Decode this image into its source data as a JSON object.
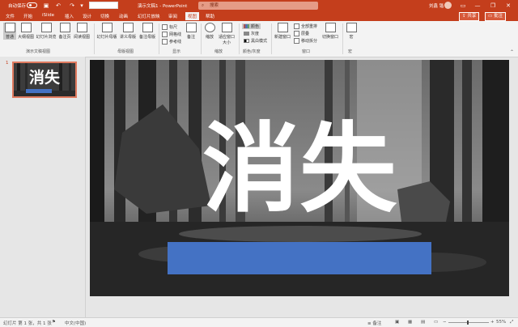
{
  "titlebar": {
    "autosave": "自动保存",
    "doc_title": "演示文稿1 - PowerPoint",
    "search_placeholder": "搜索",
    "user": "刘鑫 锴",
    "minimize": "—",
    "restore": "❐",
    "close": "✕",
    "undo": "↶",
    "redo": "↷",
    "save": "▣"
  },
  "tabs": [
    "文件",
    "开始",
    "iSlide",
    "插入",
    "设计",
    "切换",
    "动画",
    "幻灯片放映",
    "审阅",
    "视图",
    "帮助"
  ],
  "active_tab": "视图",
  "share_label": "共享",
  "comment_label": "批注",
  "ribbon": {
    "buttons": {
      "normal": "普通",
      "outline": "大纲视图",
      "sorter": "幻灯片浏览",
      "notes_page": "备注页",
      "reading": "阅读视图",
      "slide_master": "幻灯片母版",
      "handout_master": "讲义母版",
      "notes_master": "备注母版",
      "notes": "备注",
      "zoom": "缩放",
      "fit": "适应窗口大小",
      "new_window": "新建窗口",
      "switch_window": "切换窗口",
      "macro": "宏"
    },
    "show": {
      "ruler": "标尺",
      "gridlines": "网格线",
      "guides": "参考线"
    },
    "color": {
      "color": "颜色",
      "grayscale": "灰度",
      "bw": "黑白模式"
    },
    "window_items": {
      "arrange": "全部重排",
      "cascade": "层叠",
      "move_split": "移动拆分"
    },
    "groups": {
      "presentation_views": "演示文稿视图",
      "master_views": "母版视图",
      "show": "显示",
      "zoom": "缩放",
      "color": "颜色/灰度",
      "window": "窗口",
      "macro": "宏"
    }
  },
  "slide": {
    "number": "1",
    "title": "消失"
  },
  "statusbar": {
    "slide_info": "幻灯片 第 1 张，共 1 张",
    "language": "中文(中国)",
    "notes": "≡ 备注",
    "zoom": "55%",
    "minus": "−",
    "plus": "+"
  },
  "colors": {
    "accent": "#c43e1c",
    "bar": "#4472c4"
  }
}
